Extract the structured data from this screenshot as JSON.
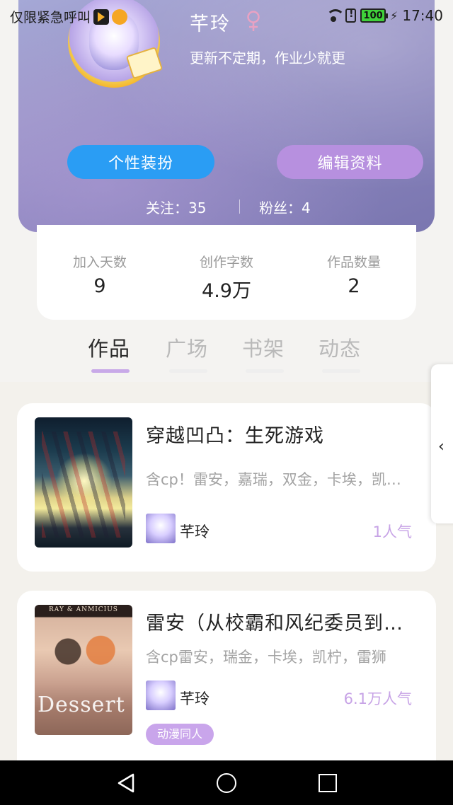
{
  "status_bar": {
    "carrier_text": "仅限紧急呼叫",
    "battery": "100",
    "time": "17:40"
  },
  "profile": {
    "username": "芊玲",
    "gender": "female-icon",
    "bio": "更新不定期，作业少就更",
    "buttons": {
      "dress_up": "个性装扮",
      "edit_profile": "编辑资料"
    },
    "follow_label": "关注：35",
    "fans_label": "粉丝：4"
  },
  "stats": [
    {
      "label": "加入天数",
      "value": "9"
    },
    {
      "label": "创作字数",
      "value": "4.9万"
    },
    {
      "label": "作品数量",
      "value": "2"
    }
  ],
  "tabs": [
    {
      "label": "作品",
      "active": true
    },
    {
      "label": "广场",
      "active": false
    },
    {
      "label": "书架",
      "active": false
    },
    {
      "label": "动态",
      "active": false
    }
  ],
  "works": [
    {
      "title": "穿越凹凸：生死游戏",
      "description": "含cp！雷安，嘉瑞，双金，卡埃，凯柠，",
      "author": "芊玲",
      "popularity": "1人气"
    },
    {
      "title": "雷安（从校霸和风纪委员到恋人）",
      "description": "含cp雷安，瑞金，卡埃，凯柠，雷狮",
      "author": "芊玲",
      "popularity": "6.1万人气",
      "cover_banner": "RAY & ANMICIUS",
      "cover_title": "Dessert",
      "tag": "动漫同人"
    }
  ],
  "colors": {
    "accent_blue": "#2a9df4",
    "accent_purple": "#b790df",
    "popularity_purple": "#c7a3e6"
  }
}
